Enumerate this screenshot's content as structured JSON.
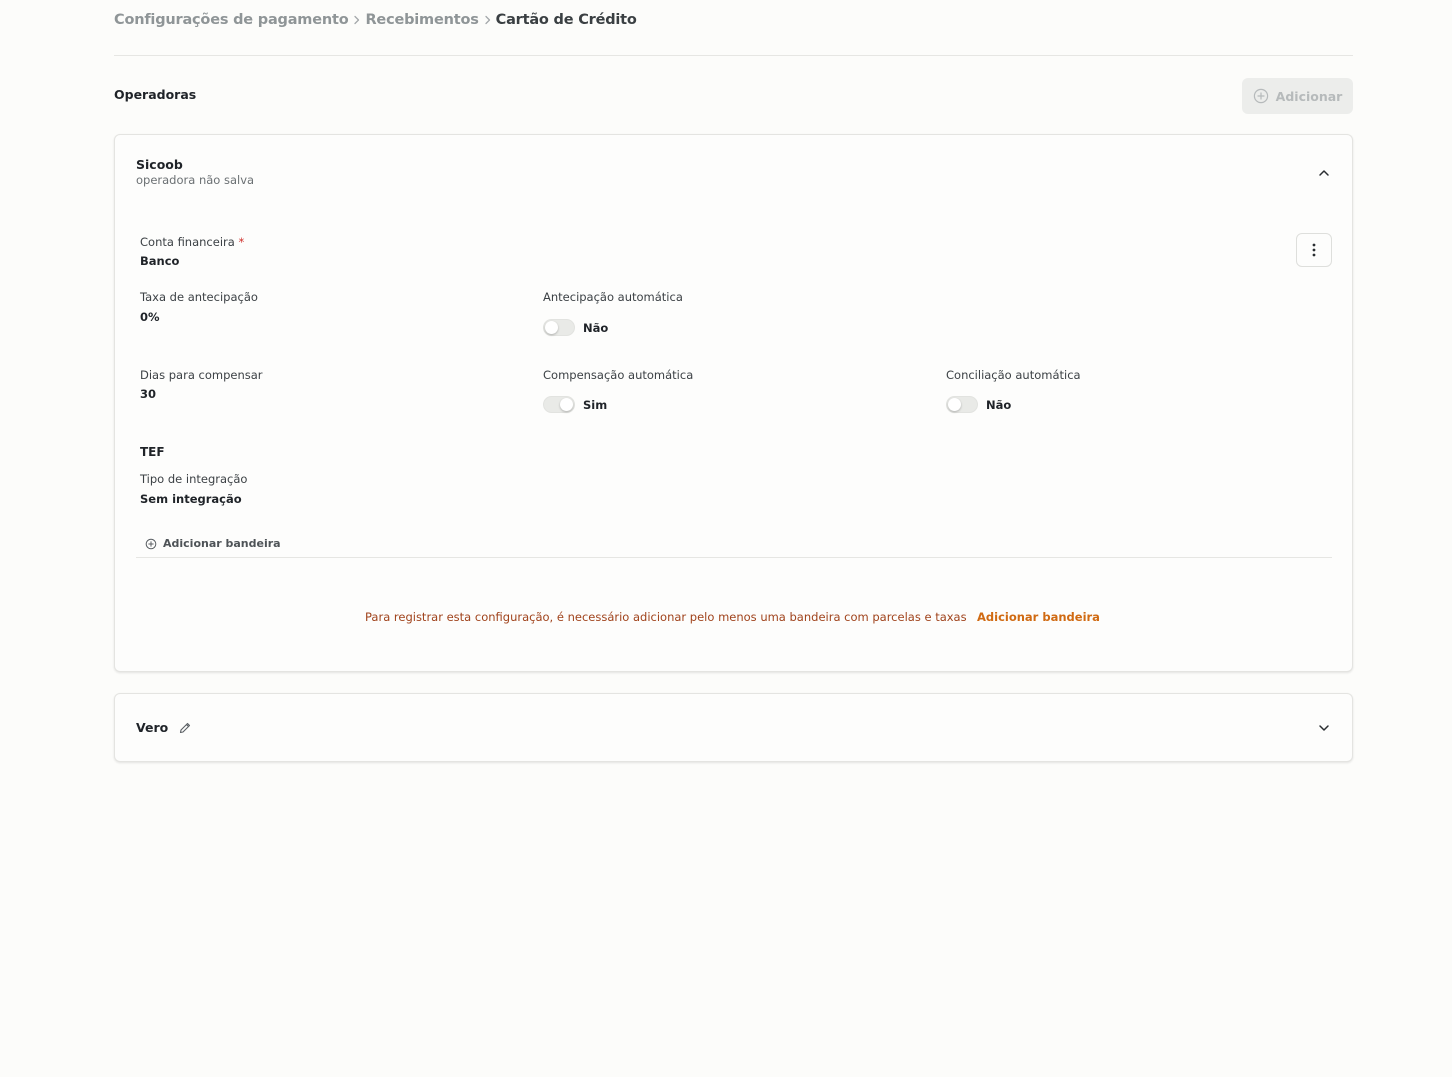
{
  "breadcrumb": {
    "items": [
      "Configurações de pagamento",
      "Recebimentos"
    ],
    "current": "Cartão de Crédito"
  },
  "section": {
    "title": "Operadoras",
    "add_label": "Adicionar"
  },
  "operators": [
    {
      "name": "Sicoob",
      "subtitle": "operadora não salva",
      "expanded": true,
      "fields": {
        "financial_account": {
          "label": "Conta financeira",
          "required_mark": "*",
          "value": "Banco"
        },
        "advance_fee": {
          "label": "Taxa de antecipação",
          "value": "0%"
        },
        "auto_advance": {
          "label": "Antecipação automática",
          "value": "Não",
          "checked": false
        },
        "days_to_clear": {
          "label": "Dias para compensar",
          "value": "30"
        },
        "auto_clear": {
          "label": "Compensação automática",
          "value": "Sim",
          "checked": true
        },
        "auto_reconcile": {
          "label": "Conciliação automática",
          "value": "Não",
          "checked": false
        }
      },
      "tef": {
        "title": "TEF",
        "integration_label": "Tipo de integração",
        "integration_value": "Sem integração"
      },
      "add_flag_label": "Adicionar bandeira",
      "warning": {
        "message": "Para registrar esta configuração, é necessário adicionar pelo menos uma bandeira com parcelas e taxas",
        "link": "Adicionar bandeira"
      }
    },
    {
      "name": "Vero",
      "expanded": false
    }
  ],
  "colors": {
    "background": "#fcfcfa",
    "warning_text": "#a0431c",
    "warning_link": "#d06a12",
    "required": "#d0312d",
    "disabled_button": "#ecedeb"
  },
  "icons": [
    "chevron-right-icon",
    "plus-circle-icon",
    "chevron-up-icon",
    "kebab-menu-icon",
    "chevron-down-icon",
    "pencil-icon"
  ]
}
